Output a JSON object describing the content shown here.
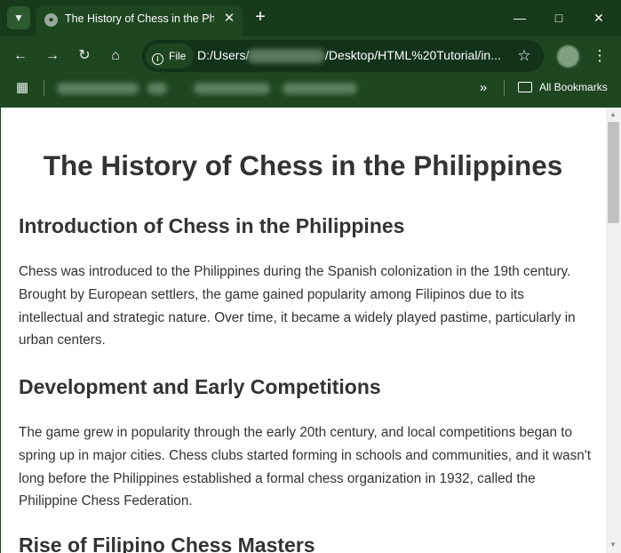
{
  "browser": {
    "tab_title": "The History of Chess in the Philippines",
    "url_scheme_label": "File",
    "url_prefix": "D:/Users/",
    "url_suffix": "/Desktop/HTML%20Tutorial/in...",
    "all_bookmarks_label": "All Bookmarks",
    "icons": {
      "tab_menu": "chevron-down-icon",
      "favicon": "globe-icon",
      "tab_close": "close-icon",
      "new_tab": "plus-icon",
      "minimize": "minimize-icon",
      "maximize": "maximize-icon",
      "close_window": "close-icon",
      "back": "arrow-left-icon",
      "forward": "arrow-right-icon",
      "reload": "reload-icon",
      "home": "home-icon",
      "info": "info-icon",
      "bookmark_star": "star-icon",
      "menu": "kebab-icon",
      "apps": "apps-grid-icon",
      "more": "double-chevron-icon",
      "folder": "folder-icon"
    }
  },
  "page": {
    "title": "The History of Chess in the Philippines",
    "sections": [
      {
        "heading": "Introduction of Chess in the Philippines",
        "body": "Chess was introduced to the Philippines during the Spanish colonization in the 19th century. Brought by European settlers, the game gained popularity among Filipinos due to its intellectual and strategic nature. Over time, it became a widely played pastime, particularly in urban centers."
      },
      {
        "heading": "Development and Early Competitions",
        "body": "The game grew in popularity through the early 20th century, and local competitions began to spring up in major cities. Chess clubs started forming in schools and communities, and it wasn't long before the Philippines established a formal chess organization in 1932, called the Philippine Chess Federation."
      },
      {
        "heading": "Rise of Filipino Chess Masters"
      }
    ]
  },
  "colors": {
    "chrome": "#1e4620",
    "tab_strip": "#173a1a",
    "text": "#333333"
  }
}
